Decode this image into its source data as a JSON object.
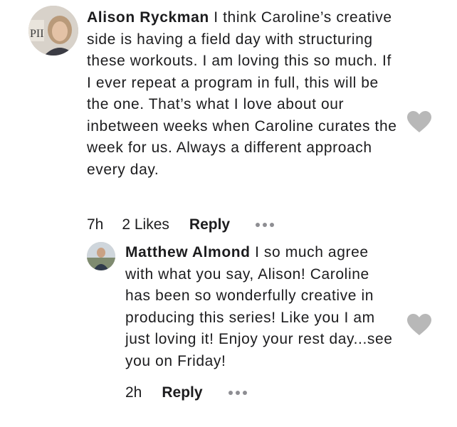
{
  "comments": [
    {
      "author": "Alison Ryckman",
      "text": "I think Caroline’s creative side is having a field day with structuring these workouts. I am loving this so much. If I ever repeat a program in full, this will be the one. That’s what I love about our inbetween weeks when Caroline curates the week for us. Always a different approach every day.",
      "time": "7h",
      "likes": "2 Likes",
      "reply_label": "Reply"
    },
    {
      "author": "Matthew Almond",
      "text": "I so much agree with what you say, Alison! Caroline has been so wonderfully creative in producing this series! Like you I am just loving it! Enjoy your rest day...see you on Friday!",
      "time": "2h",
      "reply_label": "Reply"
    }
  ],
  "icons": {
    "heart": "heart-icon",
    "more": "more-options-icon"
  },
  "colors": {
    "heart": "#b8b8b8",
    "dots": "#8e8e93"
  }
}
